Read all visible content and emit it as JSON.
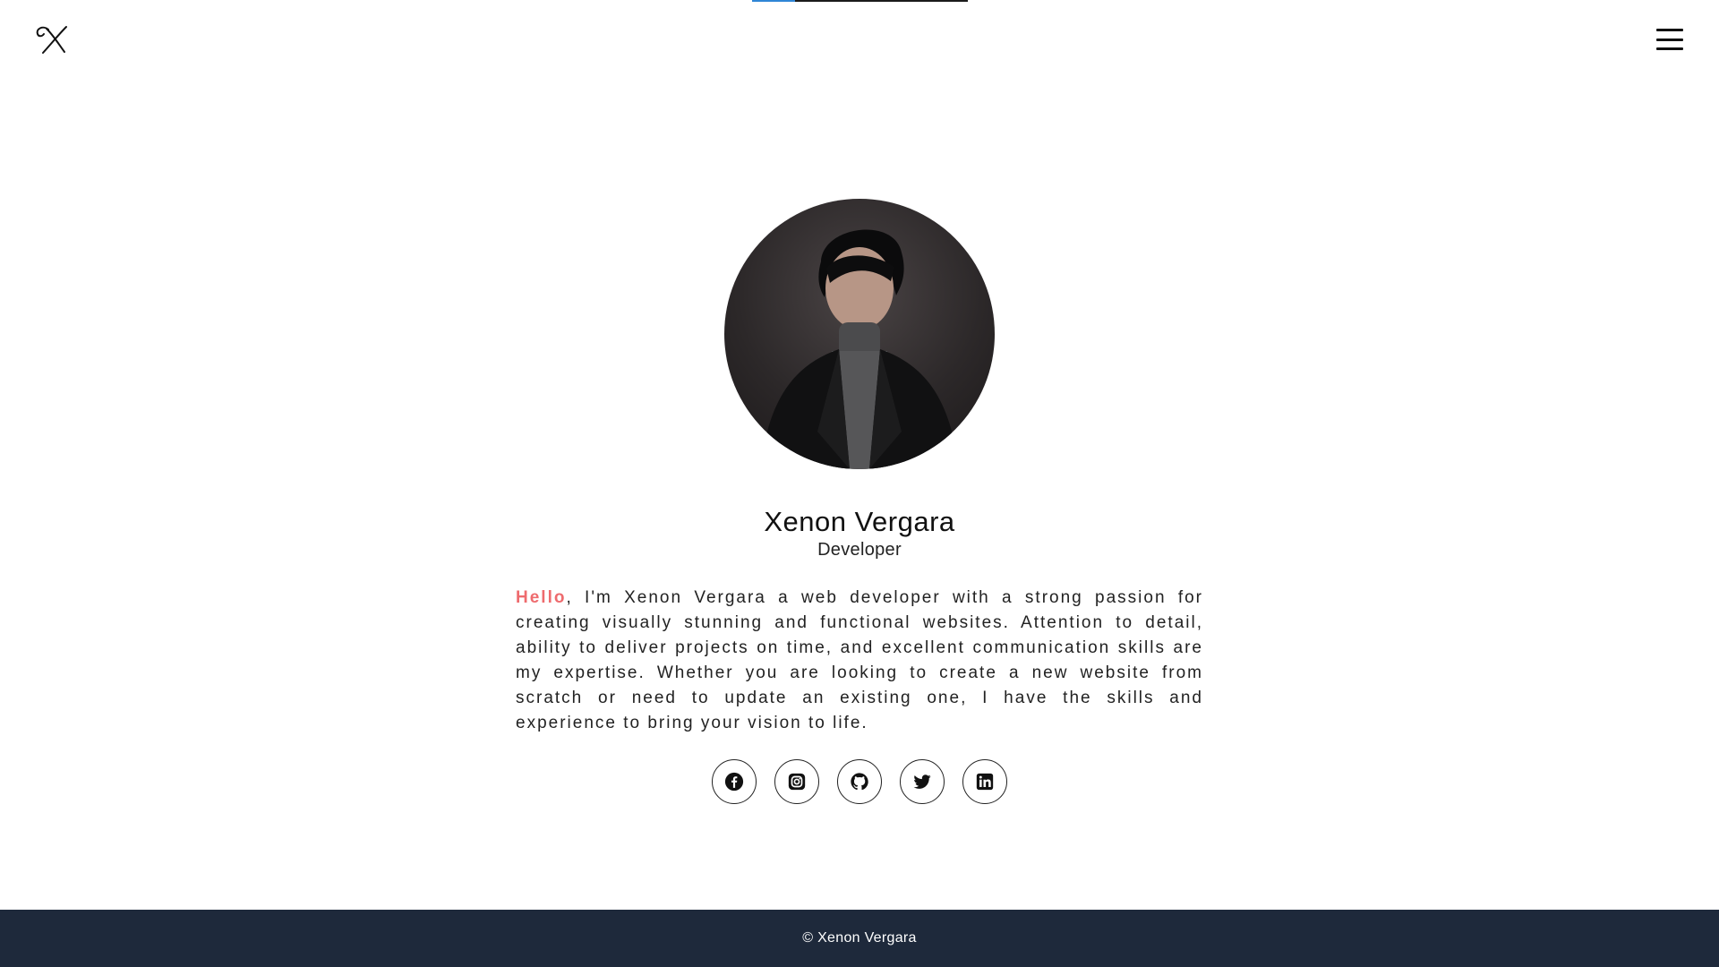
{
  "scroll_progress": {
    "value": 0.2
  },
  "header": {
    "logo_icon": "x-monogram-icon",
    "menu_icon": "hamburger-menu-icon"
  },
  "profile": {
    "name": "Xenon Vergara",
    "role": "Developer",
    "bio_highlight": "Hello",
    "bio_text": ", I'm Xenon Vergara a web developer with a strong passion for creating visually stunning and functional websites. Attention to detail, ability to deliver projects on time, and excellent communication skills are my expertise. Whether you are looking to create a new website from scratch or need to update an existing one, I have the skills and experience to bring your vision to life."
  },
  "socials": [
    {
      "icon": "facebook-icon"
    },
    {
      "icon": "instagram-icon"
    },
    {
      "icon": "github-icon"
    },
    {
      "icon": "twitter-icon"
    },
    {
      "icon": "linkedin-icon"
    }
  ],
  "footer": {
    "copyright": "© Xenon Vergara"
  },
  "colors": {
    "accent_hello": "#ee6b6e",
    "footer_bg": "#1e293b",
    "progress_fill": "#2f86d6"
  }
}
